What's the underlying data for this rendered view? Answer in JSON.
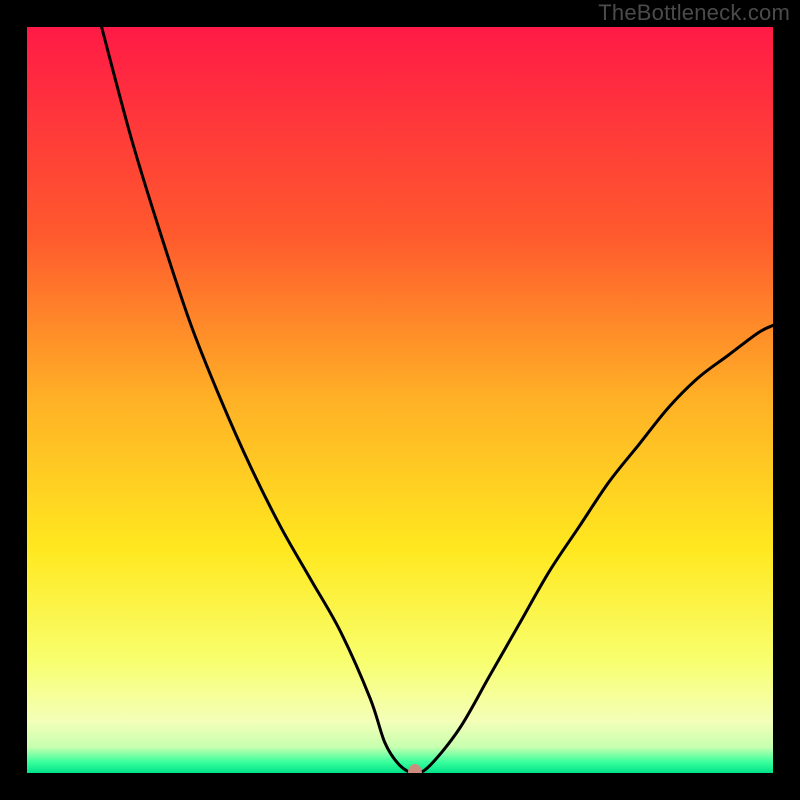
{
  "watermark": "TheBottleneck.com",
  "chart_data": {
    "type": "line",
    "title": "",
    "xlabel": "",
    "ylabel": "",
    "xlim": [
      0,
      100
    ],
    "ylim": [
      0,
      100
    ],
    "grid": false,
    "legend": false,
    "annotations": [
      {
        "name": "bottleneck-point",
        "x": 52,
        "y": 0,
        "marker": "dot",
        "color": "#cc8d7f"
      }
    ],
    "background": {
      "type": "vertical-gradient",
      "stops": [
        {
          "pos": 0.0,
          "color": "#ff1a46"
        },
        {
          "pos": 0.28,
          "color": "#ff5a2d"
        },
        {
          "pos": 0.5,
          "color": "#ffb126"
        },
        {
          "pos": 0.7,
          "color": "#ffe81f"
        },
        {
          "pos": 0.85,
          "color": "#f8ff6e"
        },
        {
          "pos": 0.93,
          "color": "#f4ffb8"
        },
        {
          "pos": 0.965,
          "color": "#c8ffb0"
        },
        {
          "pos": 0.985,
          "color": "#3bff9d"
        },
        {
          "pos": 1.0,
          "color": "#00e28a"
        }
      ]
    },
    "series": [
      {
        "name": "bottleneck-curve",
        "color": "#000000",
        "x": [
          10,
          14,
          18,
          22,
          26,
          30,
          34,
          38,
          42,
          46,
          48,
          50,
          52,
          54,
          58,
          62,
          66,
          70,
          74,
          78,
          82,
          86,
          90,
          94,
          98,
          100
        ],
        "values": [
          100,
          85,
          72,
          60,
          50,
          41,
          33,
          26,
          19,
          10,
          4,
          1,
          0,
          1,
          6,
          13,
          20,
          27,
          33,
          39,
          44,
          49,
          53,
          56,
          59,
          60
        ]
      }
    ]
  }
}
